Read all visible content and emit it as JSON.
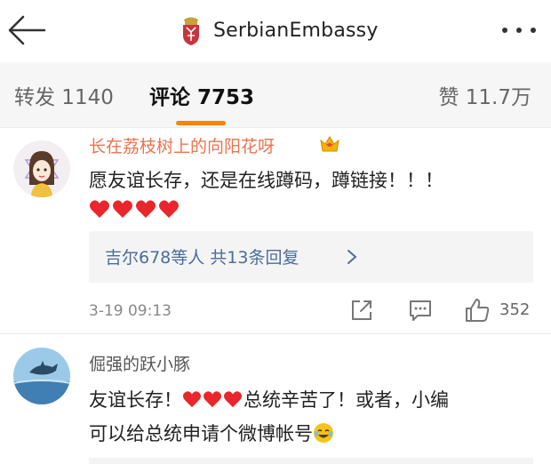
{
  "header": {
    "back_icon": "back-arrow-icon",
    "account_name": "SerbianEmbassy",
    "emblem_icon": "serbia-coat-of-arms-icon",
    "more_icon": "more-dots-icon"
  },
  "tabs": {
    "repost": "转发 1140",
    "comments": "评论 7753",
    "likes": "赞 11.7万",
    "active": "comments",
    "accent_color": "#ff8200"
  },
  "comments": [
    {
      "username": "长在荔枝树上的向阳花呀",
      "username_color": "#eb7350",
      "badge_icon": "vip-crown-badge-icon",
      "text": "愿友谊长存，还是在线蹲码，蹲链接！！！",
      "hearts": 4,
      "replies_text": "吉尔678等人 共13条回复",
      "time": "3-19 09:13",
      "like_count": "352"
    },
    {
      "username": "倔强的跃小豚",
      "text_line1_a": "友谊长存！",
      "hearts_inline": 3,
      "text_line1_b": "总统辛苦了！或者，小编",
      "text_line2": "可以给总统申请个微博帐号",
      "emoji_icon": "laugh-cry-emoji-icon"
    }
  ]
}
